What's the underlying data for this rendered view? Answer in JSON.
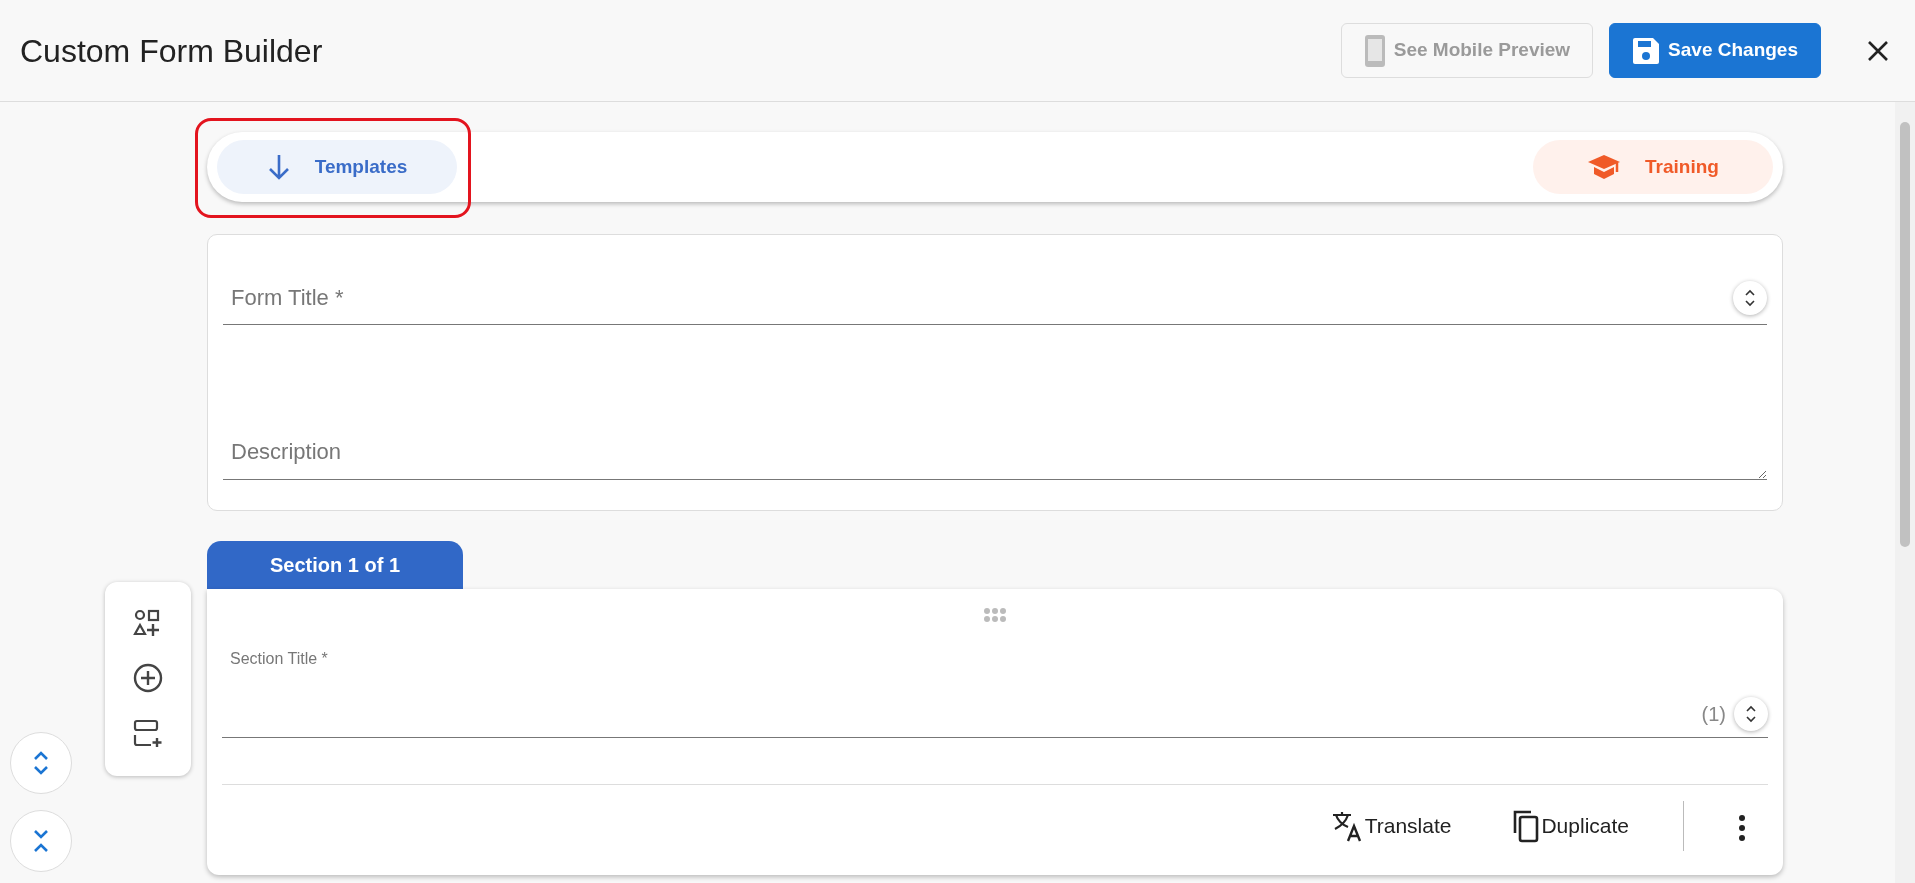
{
  "header": {
    "title": "Custom Form Builder",
    "buttons": [
      {
        "label": "See Mobile Preview",
        "kind": "preview",
        "disabled": true
      },
      {
        "label": "Save Changes",
        "kind": "save",
        "disabled": false
      }
    ]
  },
  "top_bar": {
    "buttons": [
      {
        "label": "Templates",
        "kind": "templates",
        "highlighted": true
      },
      {
        "label": "Training",
        "kind": "training",
        "highlighted": false
      }
    ]
  },
  "form": {
    "fields": [
      {
        "placeholder": "Form Title *",
        "kind": "input"
      },
      {
        "placeholder": "Description",
        "kind": "textarea"
      }
    ]
  },
  "section": {
    "tab": "Section 1 of 1",
    "field": {
      "label": "Section Title *",
      "counter": "(1)"
    },
    "actions": [
      "Translate",
      "Duplicate"
    ]
  }
}
